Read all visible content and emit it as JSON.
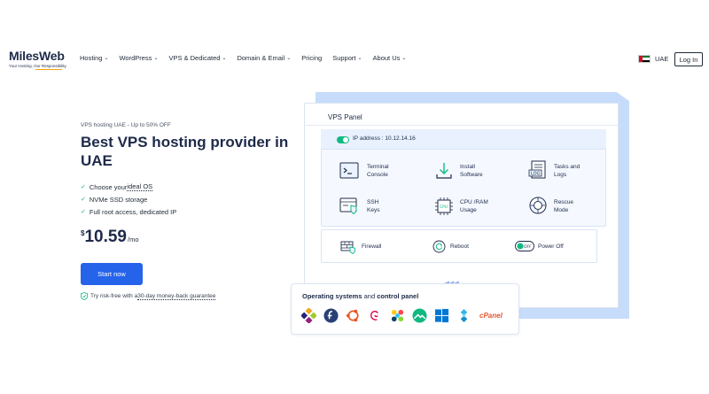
{
  "brand": {
    "name": "MilesWeb",
    "tagline": "Your Hosting, Our Responsibility."
  },
  "nav": {
    "items": [
      {
        "label": "Hosting",
        "has_dropdown": true
      },
      {
        "label": "WordPress",
        "has_dropdown": true
      },
      {
        "label": "VPS & Dedicated",
        "has_dropdown": true
      },
      {
        "label": "Domain & Email",
        "has_dropdown": true
      },
      {
        "label": "Pricing",
        "has_dropdown": false
      },
      {
        "label": "Support",
        "has_dropdown": true
      },
      {
        "label": "About Us",
        "has_dropdown": true
      }
    ],
    "region": "UAE",
    "login": "Log In"
  },
  "hero": {
    "promo": "VPS hosting UAE - Up to 50% OFF",
    "title": "Best VPS hosting provider in UAE",
    "features": [
      {
        "pre": "Choose your ",
        "link": "ideal OS",
        "post": ""
      },
      {
        "pre": "NVMe SSD storage",
        "link": "",
        "post": ""
      },
      {
        "pre": "Full root access, dedicated IP",
        "link": "",
        "post": ""
      }
    ],
    "price": {
      "currency": "$",
      "amount": "10.59",
      "period": "/mo"
    },
    "cta": "Start now",
    "guarantee_pre": "Try risk-free with a ",
    "guarantee_link": "30-day money-back guarantee"
  },
  "panel": {
    "title": "VPS Panel",
    "ip_label": "IP address : 10.12.14.16",
    "features": [
      {
        "line1": "Terminal",
        "line2": "Console",
        "icon": "terminal-icon"
      },
      {
        "line1": "Install",
        "line2": "Software",
        "icon": "download-icon"
      },
      {
        "line1": "Tasks and",
        "line2": "Logs",
        "icon": "logs-icon"
      },
      {
        "line1": "SSH",
        "line2": "Keys",
        "icon": "ssh-key-icon"
      },
      {
        "line1": "CPU /RAM",
        "line2": "Usage",
        "icon": "cpu-icon"
      },
      {
        "line1": "Rescue",
        "line2": "Mode",
        "icon": "lifebuoy-icon"
      }
    ],
    "actions": [
      {
        "label": "Firewall",
        "icon": "firewall-icon"
      },
      {
        "label": "Reboot",
        "icon": "reboot-icon"
      },
      {
        "label": "Power Off",
        "icon": "power-toggle-icon",
        "toggle_text": "OFF"
      }
    ]
  },
  "os_card": {
    "title_bold1": "Operating systems",
    "title_mid": " and ",
    "title_bold2": "control panel",
    "icons": [
      "centos-icon",
      "fedora-icon",
      "ubuntu-icon",
      "debian-icon",
      "almalinux-icon",
      "rocky-linux-icon",
      "windows-icon",
      "cloudlinux-icon"
    ],
    "cpanel": "cPanel"
  },
  "colors": {
    "primary": "#2563eb",
    "navy": "#1e2a4a",
    "accent_green": "#10b981",
    "panel_bg": "#c7dcfb"
  }
}
